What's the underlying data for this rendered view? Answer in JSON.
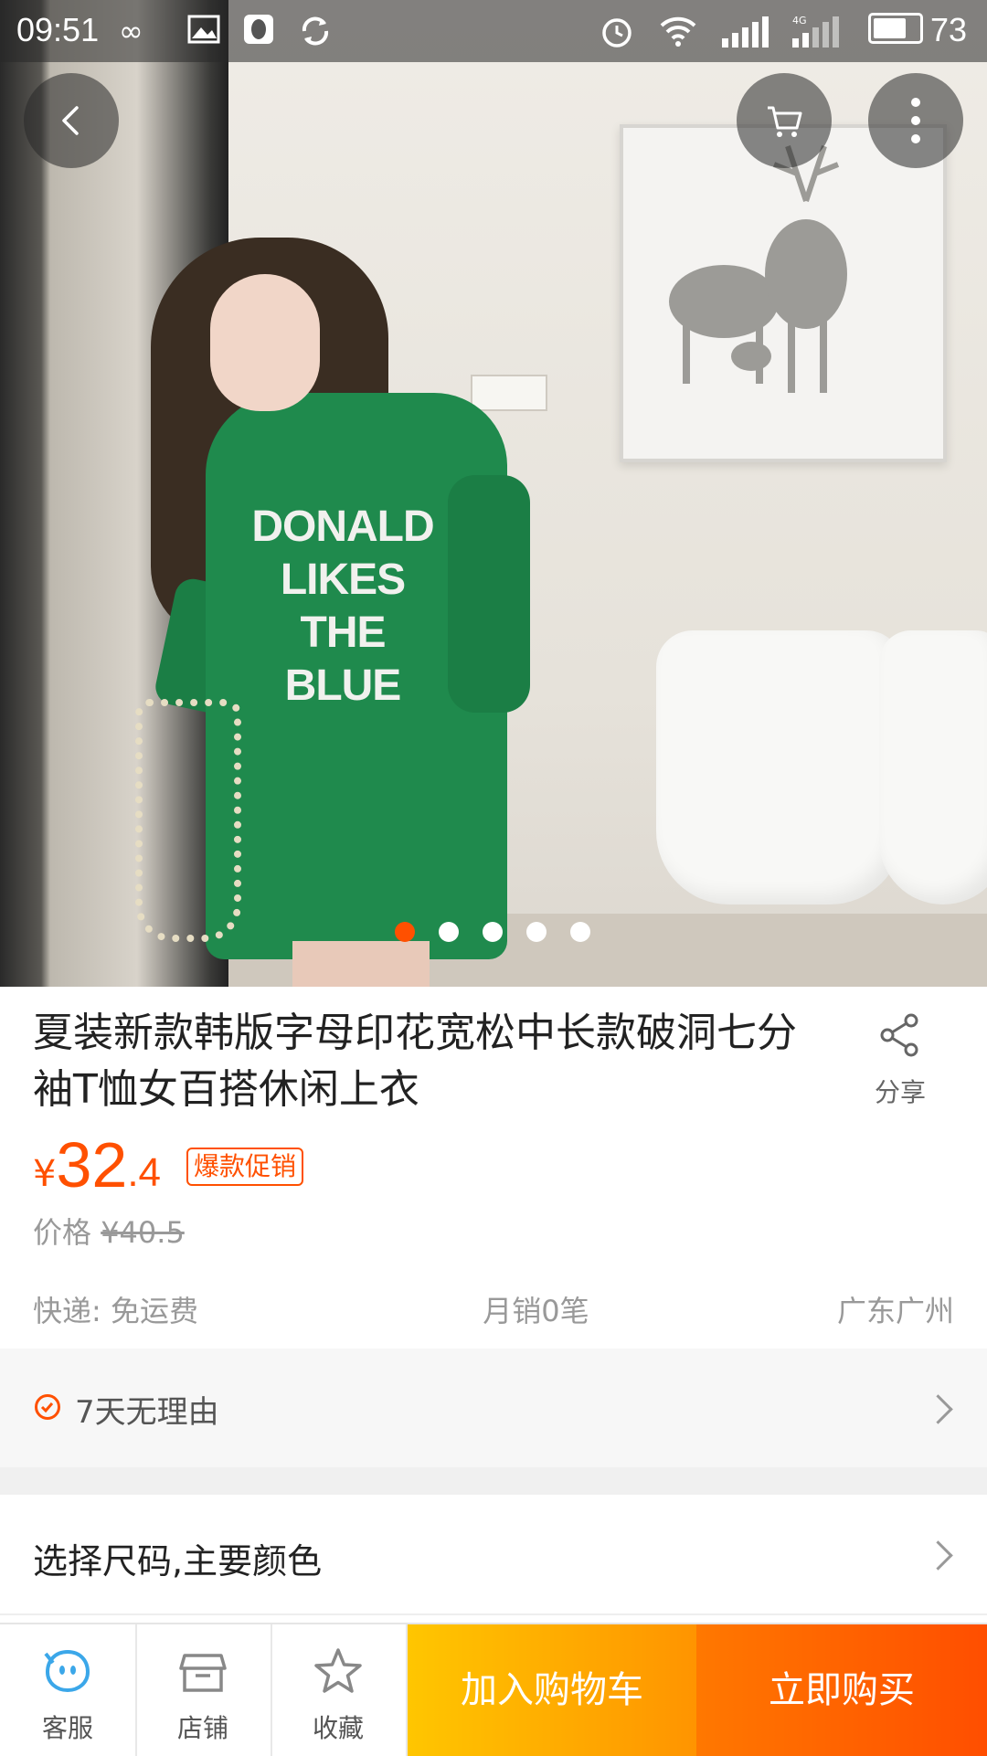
{
  "status_bar": {
    "time": "09:51",
    "battery": "73",
    "network": "4G"
  },
  "product": {
    "title": "夏装新款韩版字母印花宽松中长款破洞七分袖T恤女百搭休闲上衣",
    "shirt_print": [
      "DONALD",
      "LIKES",
      "THE",
      "BLUE"
    ],
    "image_count": 5,
    "active_image": 1
  },
  "share": {
    "label": "分享"
  },
  "price": {
    "symbol": "¥",
    "integer": "32",
    "decimal": ".4",
    "promo_badge": "爆款促销",
    "original_label": "价格",
    "original_value": "¥40.5"
  },
  "meta": {
    "shipping": "快递: 免运费",
    "monthly_sales": "月销0笔",
    "location": "广东广州"
  },
  "service": {
    "label": "7天无理由"
  },
  "sku": {
    "label": "选择尺码,主要颜色"
  },
  "bottom_bar": {
    "service_label": "客服",
    "shop_label": "店铺",
    "favorite_label": "收藏",
    "add_to_cart": "加入购物车",
    "buy_now": "立即购买"
  },
  "colors": {
    "accent": "#ff5000",
    "cart_btn": "#ffa800",
    "buy_btn": "#ff5a00",
    "service_icon": "#3ba7e9"
  }
}
